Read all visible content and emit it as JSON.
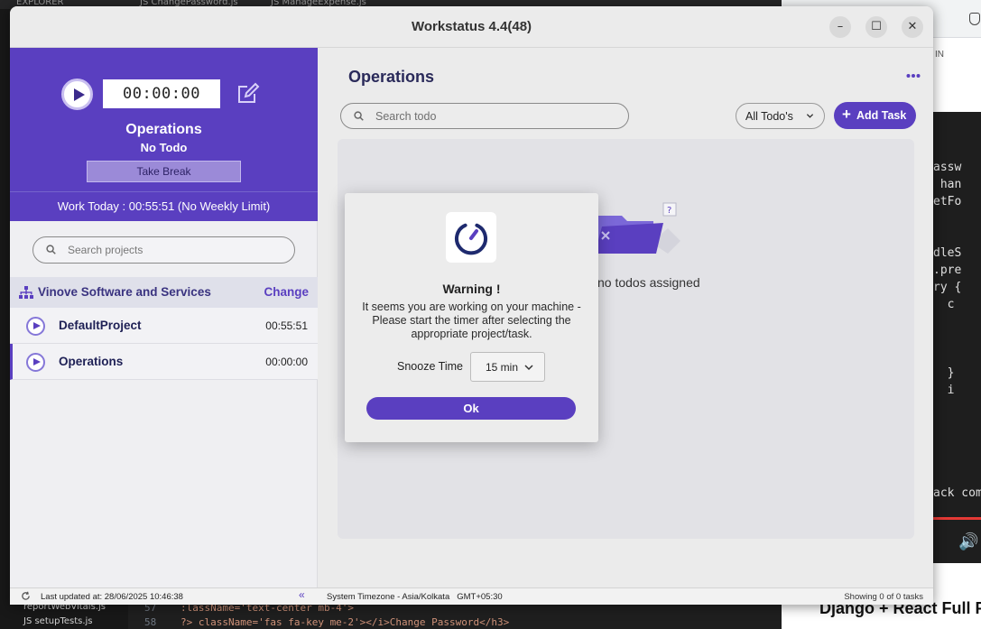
{
  "background": {
    "editor_tabs": [
      "EXPLORER",
      "JS ChangePassword.js",
      "JS ManageExpense.js"
    ],
    "editor_bottom": {
      "files": [
        "reportWebVitals.js",
        "JS setupTests.js"
      ],
      "line_numbers": [
        "57",
        "58"
      ],
      "code_lines": [
        ":lassName='text-center mb-4'>",
        "?>  className='fas fa-key me-2'></i>Change Password</h3>"
      ]
    },
    "browser_side_text": "IN",
    "browser_code_lines": [
      "assw",
      " han",
      "etFo",
      "",
      "",
      "dleS",
      ".pre",
      "ry {",
      "  c",
      "",
      "",
      "",
      "  }",
      "  i",
      "",
      "",
      "",
      "",
      "",
      "ack comp"
    ],
    "browser_video_title": "Django + React Full P"
  },
  "app": {
    "title": "Workstatus 4.4(48)",
    "window_controls": {
      "minimize": "–",
      "maximize": "☐",
      "close": "✕"
    }
  },
  "timer_panel": {
    "timer": "00:00:00",
    "project": "Operations",
    "todo": "No Todo",
    "take_break": "Take Break",
    "work_today": "Work Today :  00:55:51  (No Weekly Limit)"
  },
  "sidebar": {
    "search_placeholder": "Search projects",
    "organization": "Vinove Software and Services",
    "change_label": "Change",
    "projects": [
      {
        "name": "DefaultProject",
        "time": "00:55:51"
      },
      {
        "name": "Operations",
        "time": "00:00:00"
      }
    ]
  },
  "main": {
    "title": "Operations",
    "search_placeholder": "Search todo",
    "filter_selected": "All Todo's",
    "add_task_label": "Add Task",
    "empty_message": "no todos assigned"
  },
  "footer": {
    "last_updated": "Last updated at: 28/06/2025 10:46:38",
    "timezone": "System Timezone - Asia/Kolkata",
    "gmt_offset": "GMT+05:30",
    "showing": "Showing 0 of 0 tasks"
  },
  "modal": {
    "title": "Warning !",
    "message": "It seems you are working on your machine - Please start the timer after selecting the appropriate project/task.",
    "snooze_label": "Snooze Time",
    "snooze_value": "15 min",
    "ok_label": "Ok"
  },
  "colors": {
    "accent": "#5a3fc0",
    "panel": "#5a3fc0",
    "dark_text": "#1e2055"
  }
}
